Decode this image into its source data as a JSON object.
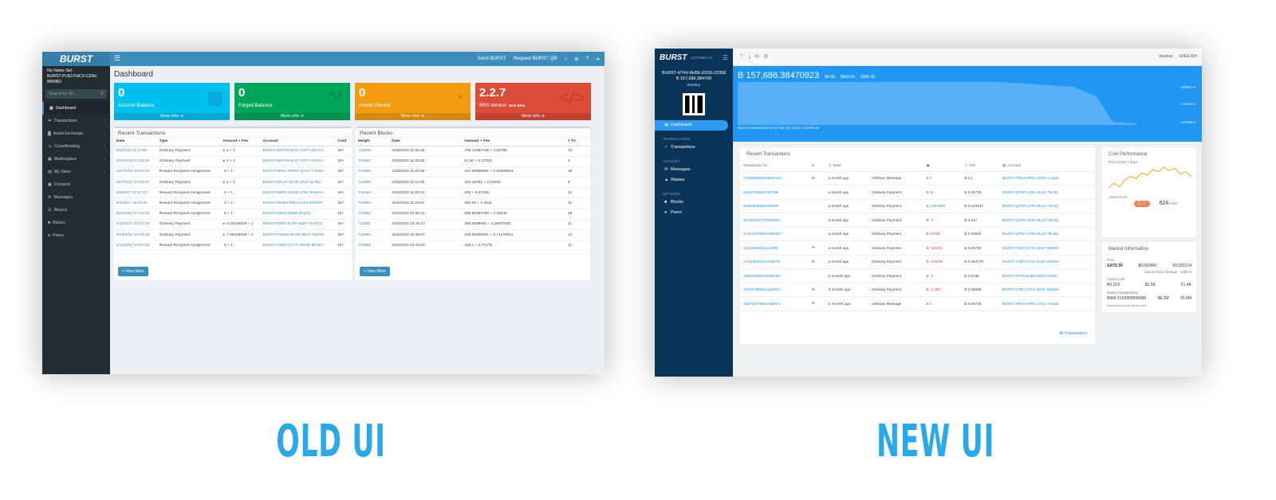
{
  "captions": {
    "old": "OLD UI",
    "new": "NEW UI"
  },
  "old_ui": {
    "logo": "BURST",
    "top_links": [
      "Send BURST",
      "Request BURST QR"
    ],
    "top_icons": [
      "home-icon",
      "share-icon",
      "help-icon",
      "logout-icon"
    ],
    "account_name": "No Name Set",
    "account_id": "BURST-PLBJ-FHCX-CDIH-8W6BD",
    "search_placeholder": "Search for ID...",
    "nav": [
      {
        "label": "Dashboard",
        "active": true,
        "caret": false,
        "icon": "dashboard-icon"
      },
      {
        "label": "Transactions",
        "active": false,
        "caret": true,
        "icon": "transactions-icon"
      },
      {
        "label": "Asset Exchange",
        "active": false,
        "caret": true,
        "icon": "chart-icon"
      },
      {
        "label": "Crowdfunding",
        "active": false,
        "caret": true,
        "icon": "crowd-icon"
      },
      {
        "label": "Marketplace",
        "active": false,
        "caret": true,
        "icon": "market-icon"
      },
      {
        "label": "My Store",
        "active": false,
        "caret": true,
        "icon": "store-icon"
      },
      {
        "label": "Contacts",
        "active": false,
        "caret": false,
        "icon": "contacts-icon"
      },
      {
        "label": "Messages",
        "active": false,
        "caret": false,
        "icon": "messages-icon"
      },
      {
        "label": "Aliases",
        "active": false,
        "caret": false,
        "icon": "aliases-icon"
      },
      {
        "label": "Blocks",
        "active": false,
        "caret": false,
        "icon": "blocks-icon"
      },
      {
        "label": "Peers",
        "active": false,
        "caret": false,
        "icon": "peers-icon"
      }
    ],
    "page_title": "Dashboard",
    "info_boxes": [
      {
        "value": "0",
        "label": "Account Balance",
        "more": "More info",
        "color": "#00c0ef",
        "icon": "briefcase-icon"
      },
      {
        "value": "0",
        "label": "Forged Balance",
        "more": "More info",
        "color": "#00a65a",
        "icon": "hammer-icon"
      },
      {
        "value": "0",
        "label": "Assets Owned",
        "more": "More info",
        "color": "#f39c12",
        "icon": "pie-icon"
      },
      {
        "value": "2.2.7",
        "label": "BRS Version",
        "badge": "New Beta",
        "more": "More info",
        "color": "#dd4b39",
        "icon": "code-icon"
      }
    ],
    "recent_transactions": {
      "title": "Recent Transactions",
      "columns": [
        "Date",
        "Type",
        "Amount + Fee",
        "Account",
        "Conf."
      ],
      "rows": [
        [
          "8/2/2018 11:11:58",
          "Ordinary Payment",
          "1 + 1",
          "BURST-WHYM-9A37-C2FY-3XAXJ",
          "18+"
        ],
        [
          "8/22/2019 11:26:26",
          "Ordinary Payment",
          "2 + 1",
          "BURST-WHYM-9A37-C2FY-3XAXJ",
          "18+"
        ],
        [
          "10/7/2017 05:52:34",
          "Reward Recipient Assignment",
          "0 + 1",
          "BURST-9PAC-EWRF-Q7N7-7N2B2",
          "18+"
        ],
        [
          "10/7/2017 17:03:17",
          "Ordinary Payment",
          "1 + 1",
          "BURST-BRAG-3X7D-Z8LT-3L7B4",
          "18+"
        ],
        [
          "6/6/2017 07:27:10",
          "Reward Recipient Assignment",
          "0 + 1",
          "BURST-B8RN-R2SB-X7BJ-8HWAA",
          "18+"
        ],
        [
          "6/4/2017 10:43:26",
          "Reward Recipient Assignment",
          "0 + 1",
          "BURST-ZE95-FXM4-UJF8-8RMYP",
          "18+"
        ],
        [
          "5/26/2017 07:13:03",
          "Reward Recipient Assignment",
          "0 + 1",
          "BURST-2DK5-R6N5-2FQ72",
          "18+"
        ],
        [
          "5/16/2017 03:17:45",
          "Ordinary Payment",
          "6.00106049 + 1",
          "BURST-5D6X-5YEK-MZFY-5A2CD",
          "18+"
        ],
        [
          "5/16/2017 03:04:48",
          "Ordinary Payment",
          "7.00106049 + 1",
          "BURST-NNMM-9FJW-SBJY-T5Z2M",
          "18+"
        ],
        [
          "5/14/2017 03:57:53",
          "Reward Recipient Assignment",
          "0 + 1",
          "BURST-JG8H-U7YX-3WHK-8PJZ3",
          "18+"
        ]
      ],
      "button": "+ View More"
    },
    "recent_blocks": {
      "title": "Recent Blocks",
      "columns": [
        "Height",
        "Date",
        "Amount + Fee",
        "# TX"
      ],
      "rows": [
        [
          "742968",
          "4/25/2020 11:32:29",
          "756.14392726 + 2.84795",
          "22"
        ],
        [
          "742967",
          "4/25/2020 11:26:02",
          "11.50 + 0.17025",
          "0"
        ],
        [
          "742966",
          "4/25/2020 11:24:59",
          "441.00098591 + 1.54009091",
          "29"
        ],
        [
          "742965",
          "4/25/2020 11:21:55",
          "313.18791 + 0.31025",
          "6"
        ],
        [
          "742964",
          "4/25/2020 11:00:22",
          "292 + 0.57185",
          "11"
        ],
        [
          "742963",
          "4/25/2020 11:00:01",
          "300.05 + 2.4811",
          "11"
        ],
        [
          "742962",
          "4/25/2020 10:56:41",
          "659.50493788 + 3.40245",
          "29"
        ],
        [
          "742961",
          "4/25/2020 10:49:13",
          "360.0009091 + 2.26670001",
          "11"
        ],
        [
          "742960",
          "4/25/2020 10:46:07",
          "325.00009091 + 0.71178001",
          "14"
        ],
        [
          "742959",
          "4/25/2020 10:44:03",
          "349.1 + 0.77175",
          "11"
        ]
      ],
      "button": "+ View More"
    }
  },
  "new_ui": {
    "logo": "BURST",
    "version": "2.0.0 Beta 14",
    "account_id": "BURST-HT4V-8H5E-E5S5-22358",
    "balance_short": "B 157,686.384709",
    "account_name": "kharkey",
    "nav_sections": [
      "TRANSACTIONS",
      "ACCOUNT",
      "NETWORK"
    ],
    "nav": {
      "dashboard": "Dashboard",
      "transactions": "Transactions",
      "messages": "Messages",
      "aliases": "Aliases",
      "blocks": "Blocks",
      "peers": "Peers"
    },
    "topbar_user": "kharkey",
    "topbar_language": "ENGLISH",
    "balance": "B 157,686.38470923",
    "balance_subs": [
      "$0.08",
      "$543.59",
      "€500.45"
    ],
    "chart_note": "Recent transactions since Nov 30, 2019, 6:30:58 AM",
    "chart_y": [
      "165857.9",
      "170444.6",
      "157686.4"
    ],
    "recent": {
      "title": "Recent Transactions",
      "columns": [
        "Transaction ID",
        "",
        "Date",
        "",
        "",
        "Fee",
        "Account"
      ],
      "rows": [
        [
          "1790958959469887161",
          "msg",
          "a month ago",
          "Arbitrary Message",
          "B 0",
          "pos",
          "B 0.1",
          "BURST-TNV4-2PRC-3G2L-ALB24"
        ],
        [
          "6190378955276079B",
          "",
          "a month ago",
          "Ordinary Payment",
          "B -5",
          "neg",
          "B 0.00735",
          "BURST-QF5P-UV5V-9L2X-79L3Q"
        ],
        [
          "8155487868128954D",
          "",
          "a month ago",
          "Ordinary Payment",
          "B 2.867553",
          "pos",
          "B 0.133447",
          "BURST-QF5P-UV5V-9L2X-79L3Q"
        ],
        [
          "167590317719885994",
          "",
          "a month ago",
          "Ordinary Payment",
          "B -7",
          "neg",
          "B 0.147",
          "BURST-QF5P-UV5V-9L2X-79L3Q"
        ],
        [
          "1741416789012462817",
          "",
          "a month ago",
          "Ordinary Payment",
          "B -0.001",
          "neg",
          "B 0.00615",
          "BURST-QF5P-UV5V-9L2X-79L3Q"
        ],
        [
          "4214183984111049B",
          "msg",
          "a month ago",
          "Ordinary Payment",
          "B -10,000",
          "neg",
          "B 0.00735",
          "BURST-Y3BT-LTYK-2DXF-8W9XA"
        ],
        [
          "171209031610168775",
          "msg",
          "a month ago",
          "Ordinary Payment",
          "B -10,000",
          "neg",
          "B 0.084778",
          "BURST-Y3BT-LTYK-2DXF-8W9XA"
        ],
        [
          "18900308053409B799",
          "",
          "2 months ago",
          "Ordinary Payment",
          "B -1",
          "neg",
          "B 0.0735",
          "BURST-HT4V-8H5E-E5S5-22358"
        ],
        [
          "19376795084142087G",
          "msg",
          "3 months ago",
          "Ordinary Payment",
          "B -1,000",
          "neg",
          "B 0.08095",
          "BURST-Y3BT-LTYK-2DXF-8W9XA"
        ],
        [
          "35671207886775962 1",
          "msg",
          "2 months ago",
          "Arbitrary Message",
          "B 0",
          "pos",
          "B 0.00735",
          "BURST-TNV4-2PRC-3G2L-ALB24"
        ]
      ],
      "all_link": "All Transactions"
    },
    "coin": {
      "title": "Coin Performance",
      "subtitle": "Price Chart 7 days",
      "grade_label": "Asset Score",
      "grade": "C +",
      "score": "624",
      "score_max": "/1000",
      "sparkline": [
        1.2,
        1.6,
        1.3,
        1.9,
        2.2,
        2.0,
        2.5,
        2.3,
        2.8,
        2.6,
        3.0,
        2.7,
        2.9,
        2.4,
        2.6,
        2.2
      ]
    },
    "market": {
      "title": "Market Information",
      "price_label": "Price",
      "price": [
        "SATS 50",
        "$0.003441",
        "€0.003174"
      ],
      "change_label": "Last 24 Hour Change",
      "change": "3.60 %",
      "volume_label": "Volume 24h",
      "volume": [
        "B0.219",
        "$1.5K",
        "€1.4K"
      ],
      "cap_label": "Market Capitalization",
      "cap": [
        "B906 5169999999999",
        "$6.2M",
        "€5.8M"
      ],
      "footnote": "Information by coin gecko.com"
    }
  }
}
